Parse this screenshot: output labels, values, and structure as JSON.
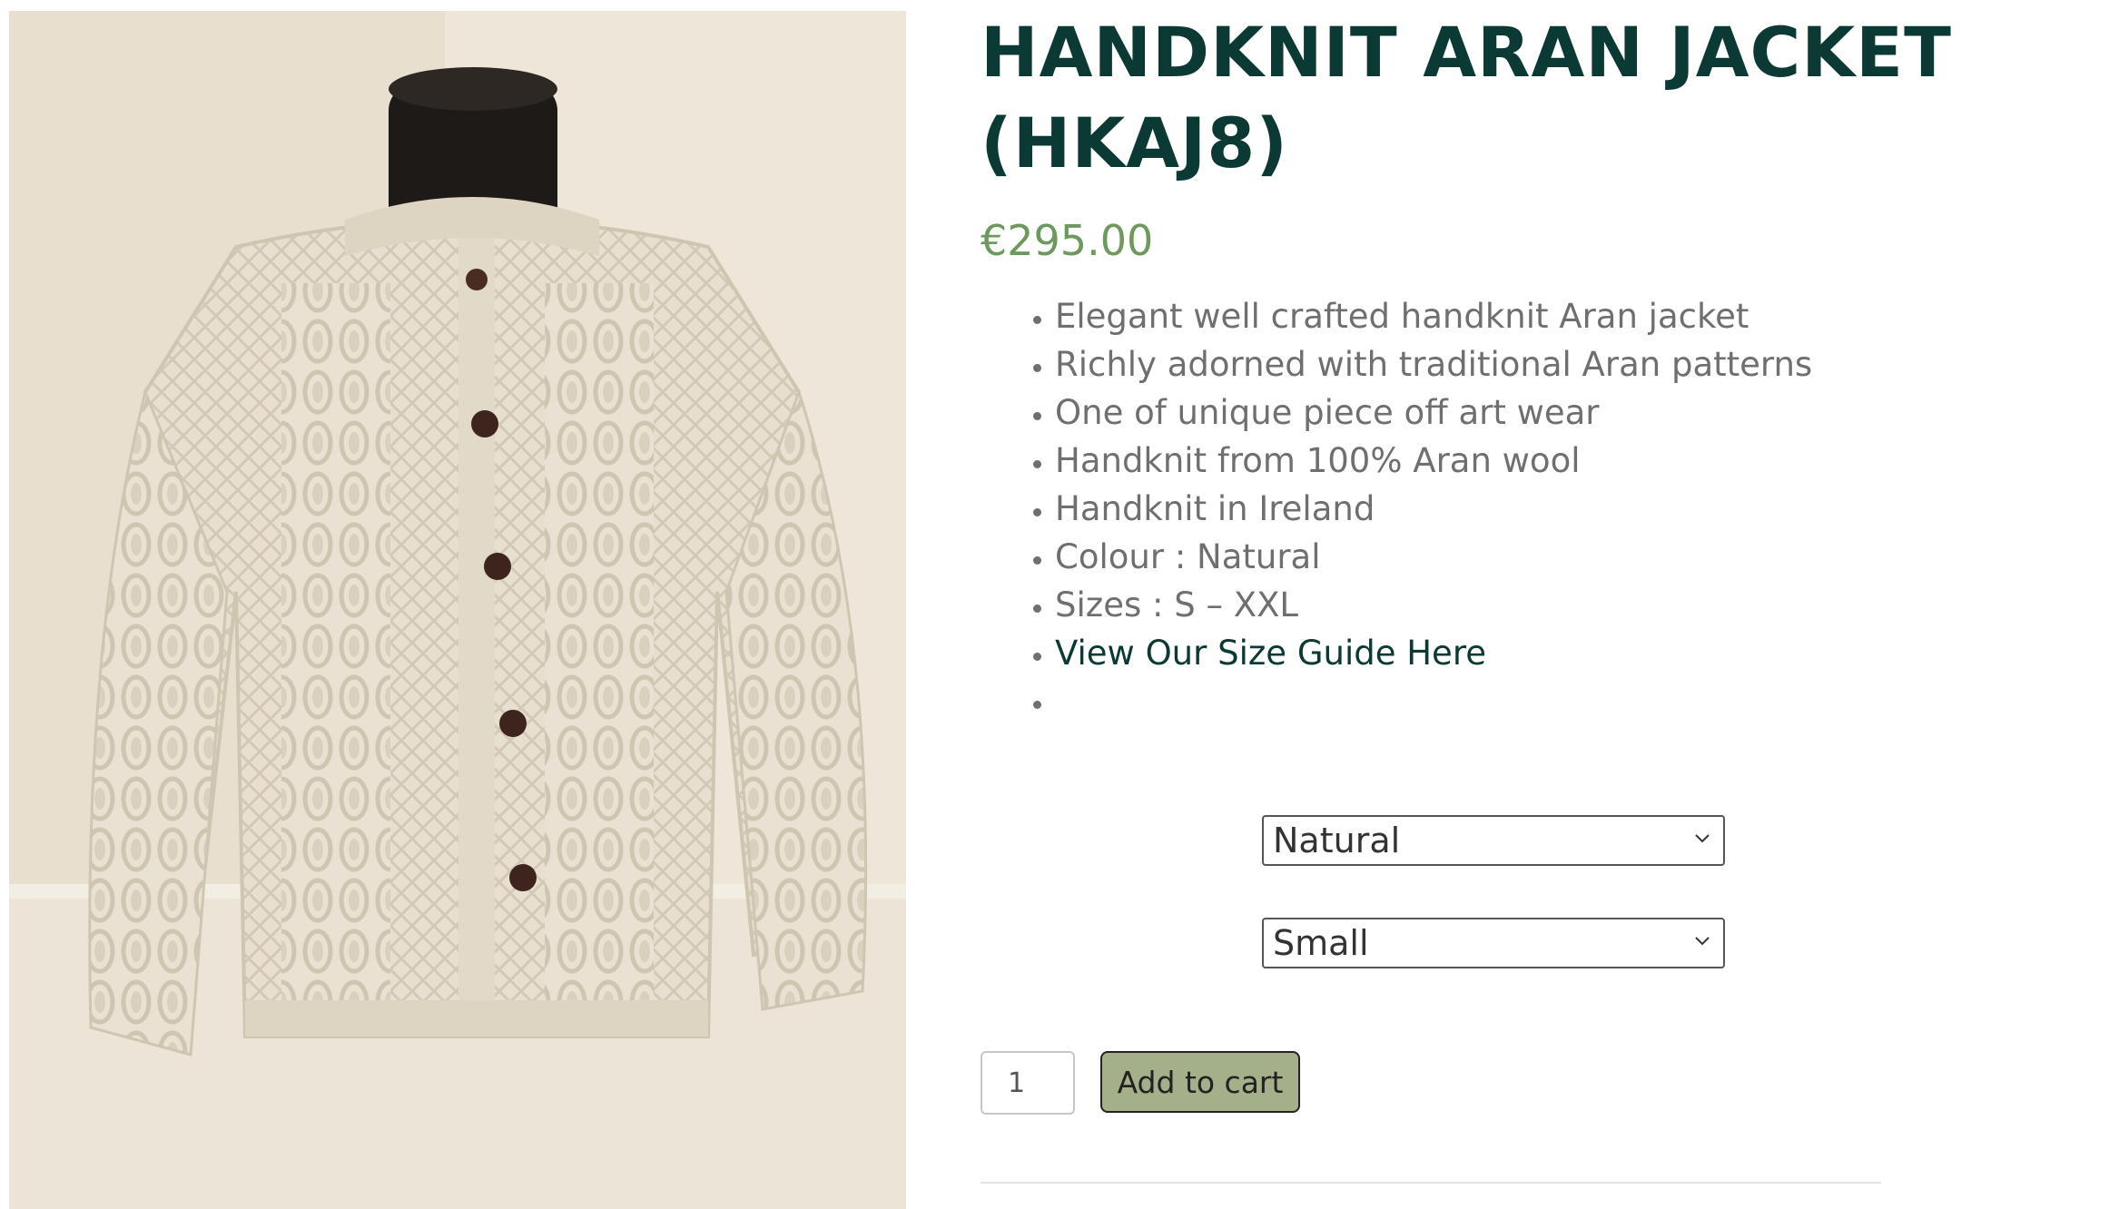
{
  "product": {
    "title": "HANDKNIT ARAN JACKET (HKAJ8)",
    "price": "€295.00",
    "features": [
      "Elegant well crafted handknit Aran jacket",
      "Richly adorned with traditional Aran patterns",
      "One of unique piece off art wear",
      "Handknit from 100% Aran wool",
      "Handknit in Ireland",
      "Colour : Natural",
      "Sizes : S – XXL"
    ],
    "size_guide_link": "View Our Size Guide Here",
    "empty_bullet": ""
  },
  "options": {
    "colour_selected": "Natural",
    "size_selected": "Small"
  },
  "cart": {
    "quantity": "1",
    "add_to_cart_label": "Add to cart"
  },
  "colors": {
    "title": "#0b3a35",
    "price": "#6c9a5d",
    "button_bg": "#a4b08a"
  }
}
